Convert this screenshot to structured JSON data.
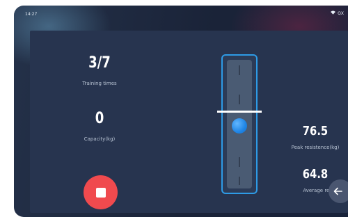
{
  "status_bar": {
    "time": "14:27",
    "battery_text": "QX"
  },
  "stats": {
    "training_times": {
      "value": "3/7",
      "label": "Training times"
    },
    "capacity": {
      "value": "0",
      "label": "Capacity(kg)"
    },
    "peak_resistance": {
      "value": "76.5",
      "label": "Peak resistence(kg)"
    },
    "average_resistance": {
      "value": "64.8",
      "label": "Average resistance(k"
    }
  },
  "resistance_slider": {
    "level_fraction": 0.5
  },
  "colors": {
    "panel": "#27344f",
    "accent_blue": "#2e9be6",
    "stop_red": "#f04a4e"
  },
  "icons": {
    "stop": "stop-square-icon",
    "back": "arrow-left-icon",
    "wifi": "wifi-icon"
  }
}
